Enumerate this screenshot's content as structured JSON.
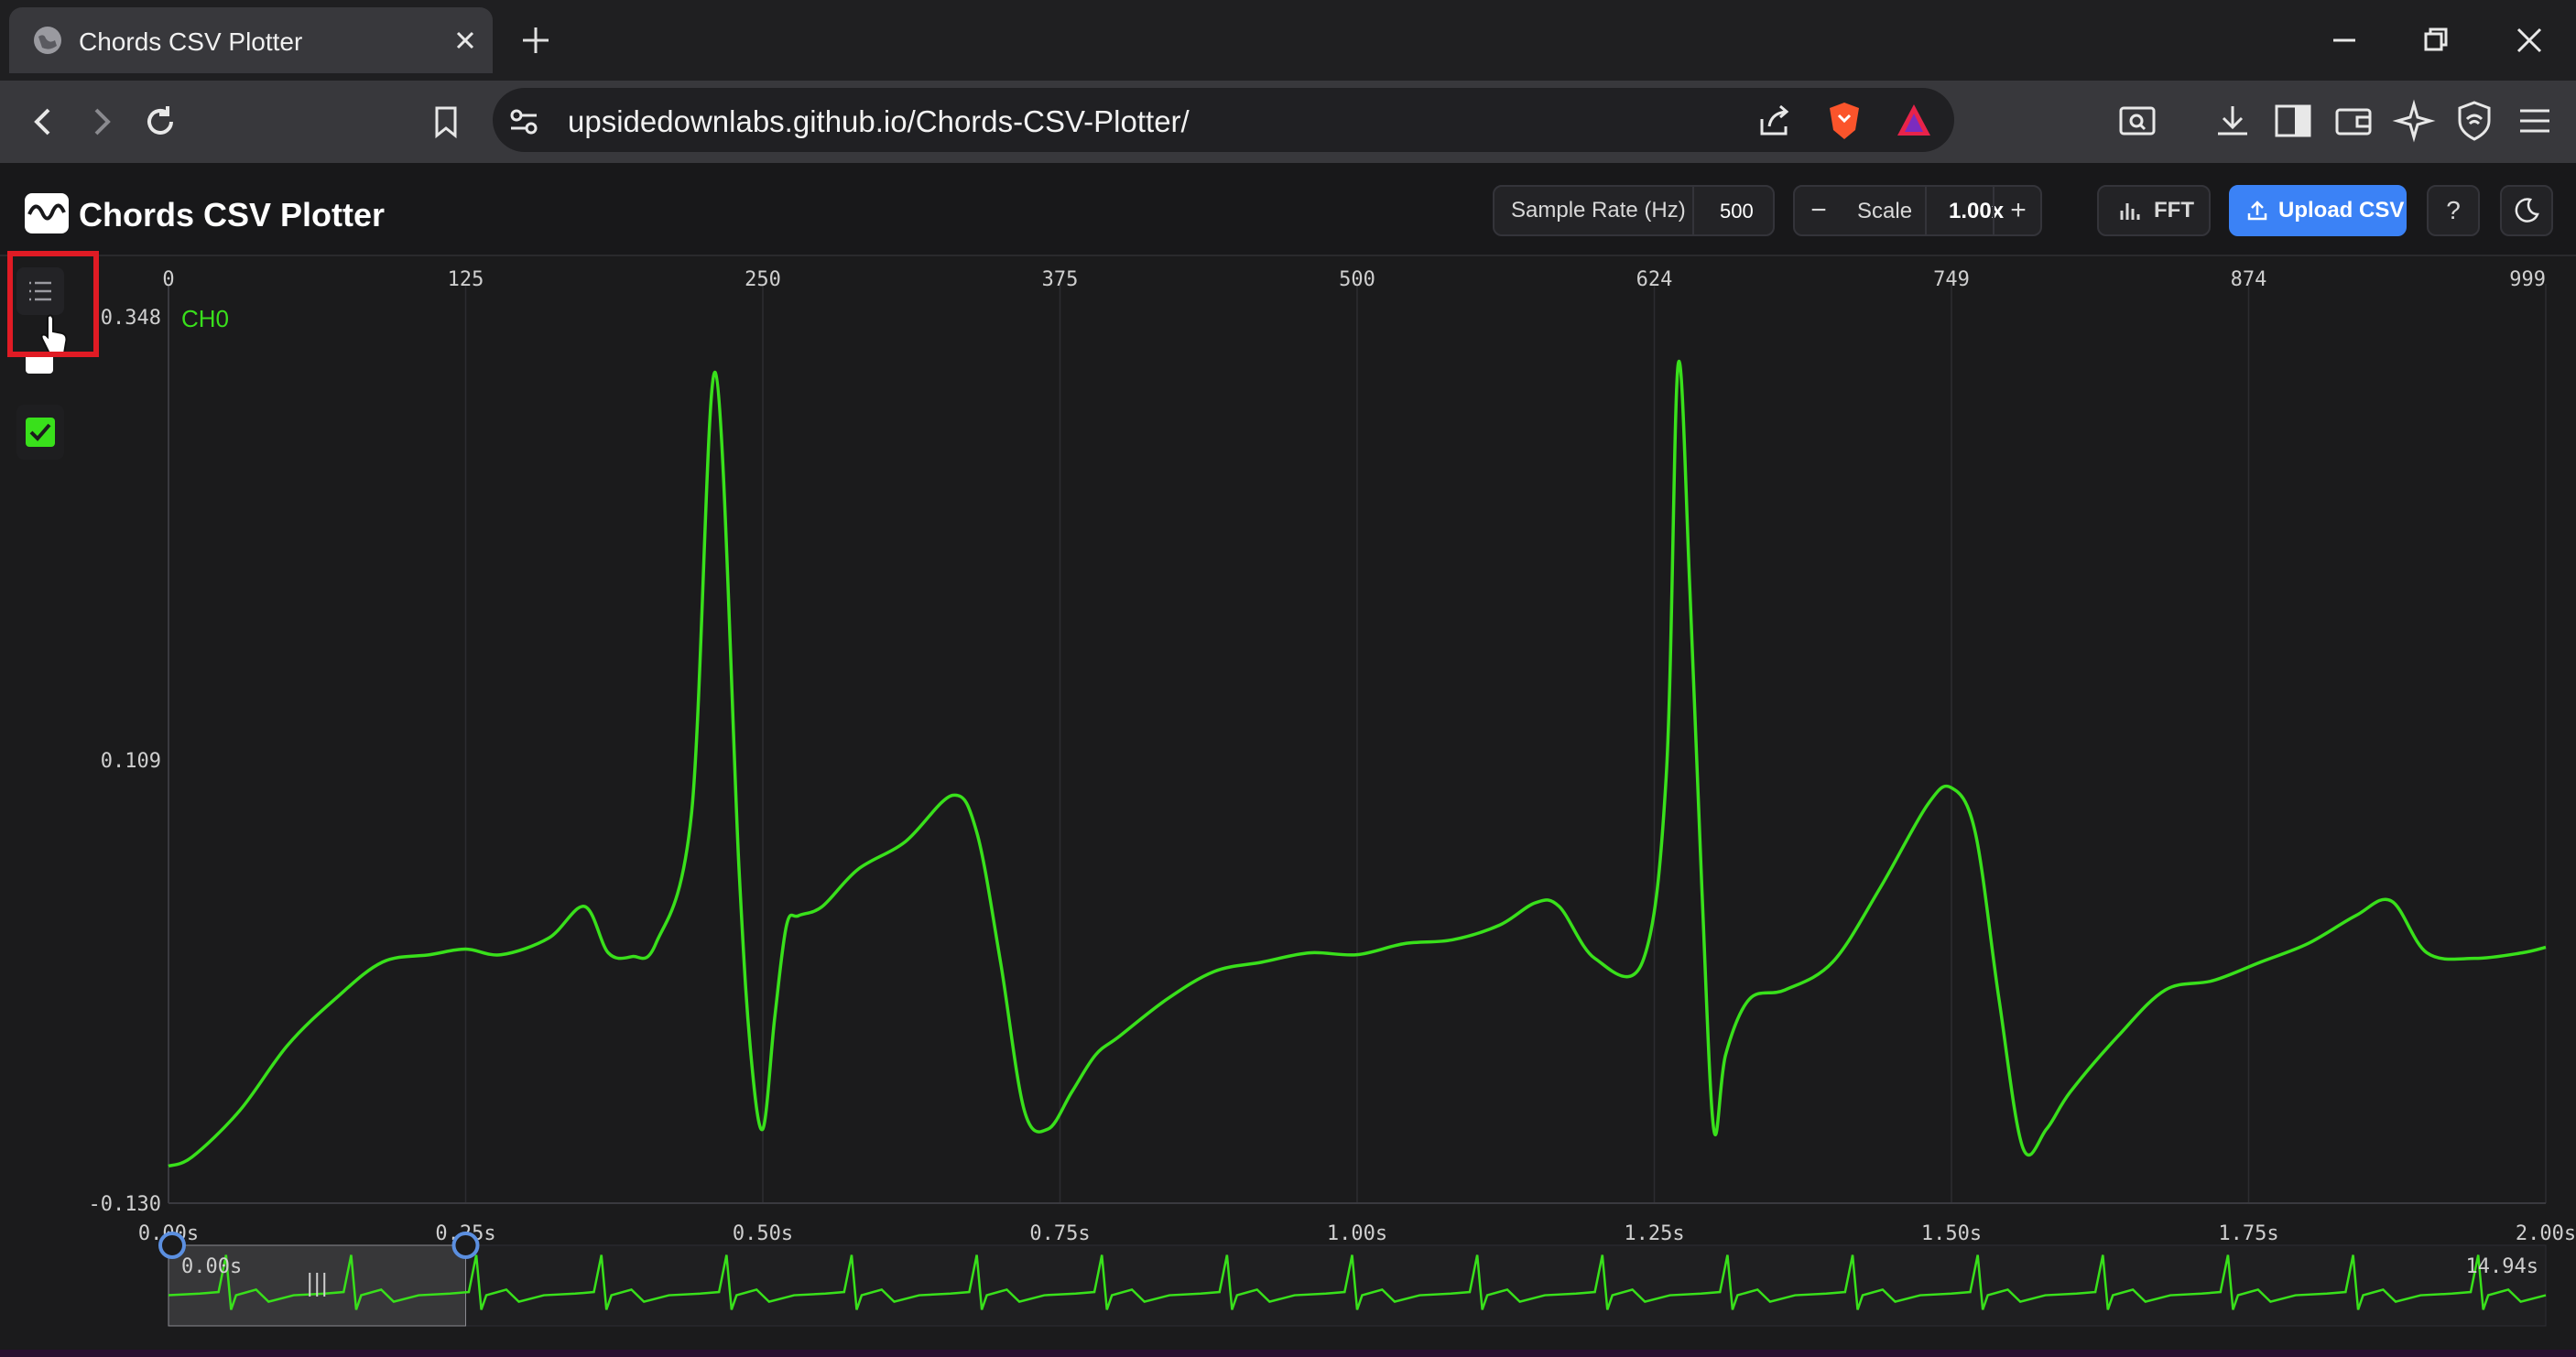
{
  "browser": {
    "tab_title": "Chords CSV Plotter",
    "url": "upsidedownlabs.github.io/Chords-CSV-Plotter/"
  },
  "app": {
    "title": "Chords CSV Plotter",
    "sample_rate_label": "Sample Rate (Hz)",
    "sample_rate_value": "500",
    "scale_label": "Scale",
    "scale_value": "1.00x",
    "minus_label": "−",
    "plus_label": "+",
    "fft_label": "FFT",
    "upload_label": "Upload CSV",
    "help_label": "?"
  },
  "channel": {
    "name": "CH0",
    "color": "#39e01b",
    "enabled": true
  },
  "chart_data": {
    "type": "line",
    "top_ticks": [
      "0",
      "125",
      "250",
      "375",
      "500",
      "624",
      "749",
      "874",
      "999"
    ],
    "y_ticks": [
      "0.348",
      "0.109",
      "-0.130"
    ],
    "ylim": [
      -0.13,
      0.348
    ],
    "time_ticks": [
      "0.00s",
      "0.25s",
      "0.50s",
      "0.75s",
      "1.00s",
      "1.25s",
      "1.50s",
      "1.75s",
      "2.00s"
    ],
    "xlim": [
      0,
      2.0
    ],
    "series": [
      {
        "name": "CH0",
        "x": [
          0,
          0.02,
          0.06,
          0.1,
          0.14,
          0.18,
          0.22,
          0.25,
          0.28,
          0.32,
          0.35,
          0.37,
          0.39,
          0.41,
          0.44,
          0.46,
          0.48,
          0.49,
          0.5,
          0.51,
          0.52,
          0.53,
          0.55,
          0.58,
          0.62,
          0.66,
          0.68,
          0.7,
          0.72,
          0.74,
          0.76,
          0.78,
          0.8,
          0.84,
          0.88,
          0.92,
          0.96,
          1.0,
          1.04,
          1.08,
          1.12,
          1.15,
          1.17,
          1.2,
          1.24,
          1.26,
          1.27,
          1.28,
          1.29,
          1.3,
          1.31,
          1.33,
          1.36,
          1.4,
          1.44,
          1.48,
          1.5,
          1.52,
          1.54,
          1.56,
          1.58,
          1.6,
          1.64,
          1.68,
          1.72,
          1.76,
          1.8,
          1.84,
          1.87,
          1.9,
          1.94,
          1.98,
          2.0
        ],
        "y": [
          -0.11,
          -0.105,
          -0.08,
          -0.045,
          -0.02,
          0.0,
          0.004,
          0.007,
          0.004,
          0.013,
          0.03,
          0.005,
          0.003,
          0.01,
          0.08,
          0.318,
          0.05,
          -0.05,
          -0.09,
          -0.03,
          0.02,
          0.025,
          0.03,
          0.05,
          0.065,
          0.09,
          0.07,
          0.0,
          -0.08,
          -0.09,
          -0.07,
          -0.05,
          -0.04,
          -0.02,
          -0.005,
          0.0,
          0.005,
          0.004,
          0.01,
          0.012,
          0.02,
          0.032,
          0.03,
          0.002,
          0.0,
          0.1,
          0.322,
          0.2,
          0.04,
          -0.09,
          -0.05,
          -0.02,
          -0.015,
          0.0,
          0.04,
          0.085,
          0.094,
          0.07,
          -0.02,
          -0.1,
          -0.09,
          -0.07,
          -0.04,
          -0.015,
          -0.01,
          0.0,
          0.01,
          0.025,
          0.033,
          0.005,
          0.002,
          0.005,
          0.008
        ]
      }
    ],
    "overview": {
      "start_label": "0.00s",
      "end_label": "14.94s",
      "selection": [
        0,
        0.25
      ]
    }
  }
}
